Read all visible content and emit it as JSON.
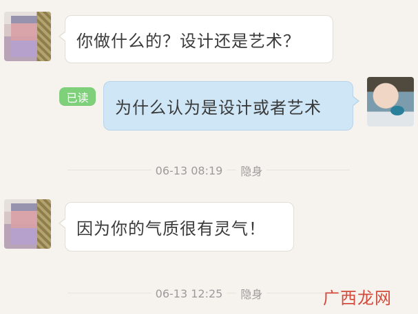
{
  "messages": [
    {
      "side": "left",
      "text": "你做什么的？设计还是艺术？"
    },
    {
      "side": "right",
      "text": "为什么认为是设计或者艺术",
      "read_label": "已读"
    },
    {
      "side": "left",
      "text": "因为你的气质很有灵气！"
    }
  ],
  "timestamps": [
    {
      "time": "06-13 08:19",
      "status": "隐身"
    },
    {
      "time": "06-13 12:25",
      "status": "隐身"
    }
  ],
  "watermark": "广西龙网",
  "colors": {
    "background": "#f6f3ee",
    "right_bubble": "#cfe6f7",
    "read_badge": "#7fd07b",
    "watermark": "#d24b3c"
  }
}
